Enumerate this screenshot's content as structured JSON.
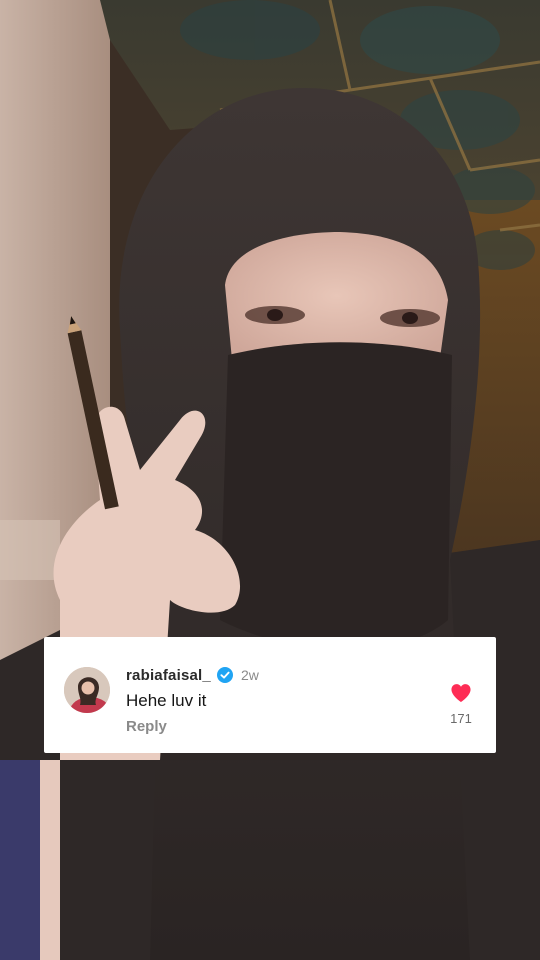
{
  "comment": {
    "username": "rabiafaisal_",
    "verified": true,
    "time_ago": "2w",
    "text": "Hehe luv it",
    "reply_label": "Reply",
    "like_count": "171"
  },
  "icons": {
    "verified": "verified-badge-icon",
    "like": "heart-icon"
  },
  "colors": {
    "card_background": "#ffffff",
    "verified_blue": "#20a4f3",
    "like_red": "#fe2c55",
    "muted_text": "#8a8a8a"
  }
}
